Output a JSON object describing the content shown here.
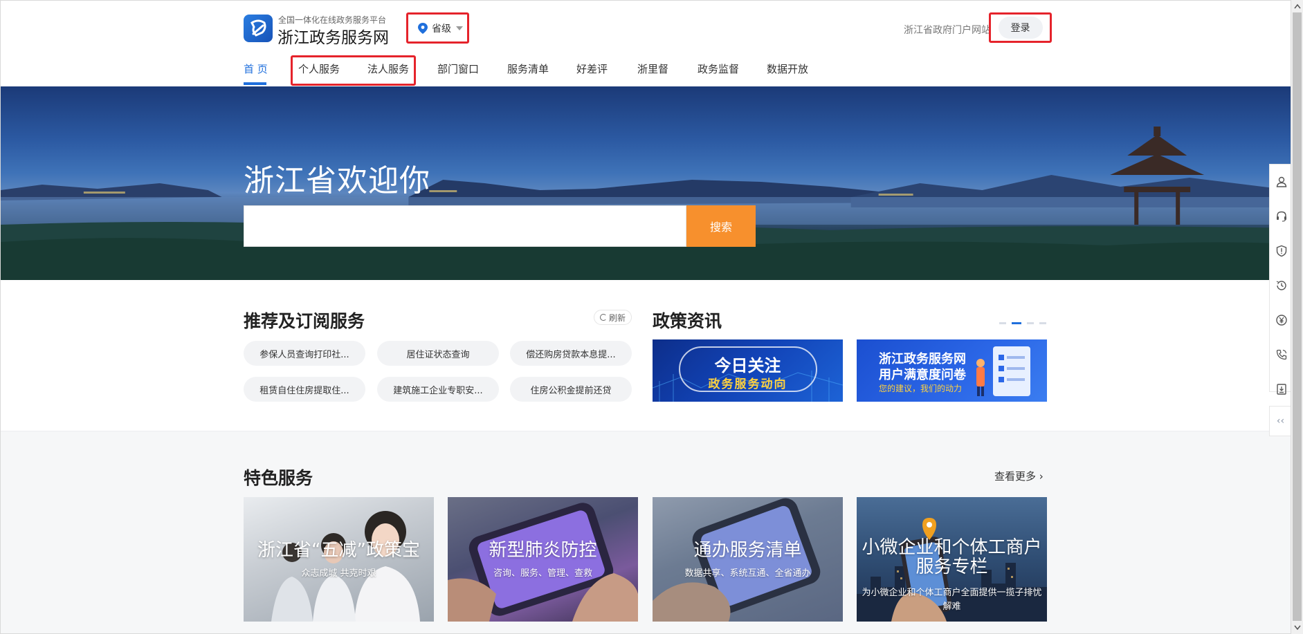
{
  "header": {
    "subtitle": "全国一体化在线政务服务平台",
    "title": "浙江政务服务网",
    "location": "省级",
    "portal_link": "浙江省政府门户网站",
    "login": "登录"
  },
  "nav": {
    "items": [
      "首 页",
      "个人服务",
      "法人服务",
      "部门窗口",
      "服务清单",
      "好差评",
      "浙里督",
      "政务监督",
      "数据开放"
    ]
  },
  "banner": {
    "welcome": "浙江省欢迎你",
    "search_value": "",
    "search_button": "搜索"
  },
  "recommend": {
    "title": "推荐及订阅服务",
    "refresh": "刷新",
    "items": [
      "参保人员查询打印社...",
      "居住证状态查询",
      "偿还购房贷款本息提...",
      "租赁自住住房提取住...",
      "建筑施工企业专职安...",
      "住房公积金提前还贷"
    ]
  },
  "policy": {
    "title": "政策资讯",
    "banner1": {
      "line1": "今日关注",
      "line2": "政务服务动向"
    },
    "banner2": {
      "line1": "浙江政务服务网",
      "line2": "用户满意度问卷",
      "line3": "您的建议，我们的动力"
    }
  },
  "feature": {
    "title": "特色服务",
    "more": "查看更多",
    "cards": [
      {
        "title": "浙江省“五减”政策宝",
        "subtitle": "众志成城 共克时艰"
      },
      {
        "title": "新型肺炎防控",
        "subtitle": "咨询、服务、管理、查救"
      },
      {
        "title": "通办服务清单",
        "subtitle": "数据共享、系统互通、全省通办"
      },
      {
        "title": "小微企业和个体工商户",
        "title2": "服务专栏",
        "subtitle": "为小微企业和个体工商户全面提供一揽子排忧",
        "subtitle2": "解难"
      }
    ]
  },
  "colors": {
    "accent": "#1f6fdc",
    "search_button": "#f7902d",
    "highlight_border": "#e5232b"
  }
}
